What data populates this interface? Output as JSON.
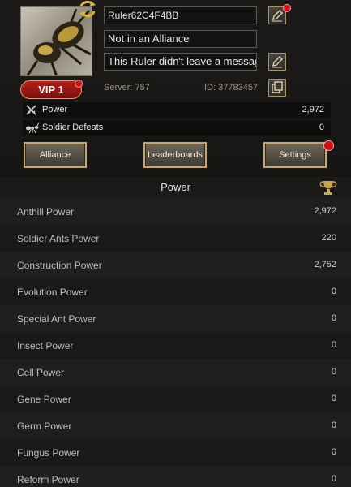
{
  "profile": {
    "ruler_name": "Ruler62C4F4BB",
    "alliance": "Not in an Alliance",
    "message": "This Ruler didn't leave a message",
    "vip": "VIP 1",
    "server": "Server: 757",
    "id": "ID: 37783457"
  },
  "stats": [
    {
      "label": "Power",
      "value": "2,972",
      "icon": "crossed-swords-icon"
    },
    {
      "label": "Soldier Defeats",
      "value": "0",
      "icon": "ant-icon"
    }
  ],
  "buttons": {
    "alliance": "Alliance",
    "leaderboards": "Leaderboards",
    "settings": "Settings"
  },
  "section": {
    "title": "Power"
  },
  "power_breakdown": [
    {
      "label": "Anthill Power",
      "value": "2,972"
    },
    {
      "label": "Soldier Ants Power",
      "value": "220"
    },
    {
      "label": "Construction Power",
      "value": "2,752"
    },
    {
      "label": "Evolution Power",
      "value": "0"
    },
    {
      "label": "Special Ant Power",
      "value": "0"
    },
    {
      "label": "Insect Power",
      "value": "0"
    },
    {
      "label": "Cell Power",
      "value": "0"
    },
    {
      "label": "Gene Power",
      "value": "0"
    },
    {
      "label": "Germ Power",
      "value": "0"
    },
    {
      "label": "Fungus Power",
      "value": "0"
    },
    {
      "label": "Reform Power",
      "value": "0"
    }
  ],
  "colors": {
    "accent_gold": "#c8a86a",
    "notification_red": "#d31010",
    "vip_red": "#b62018"
  }
}
